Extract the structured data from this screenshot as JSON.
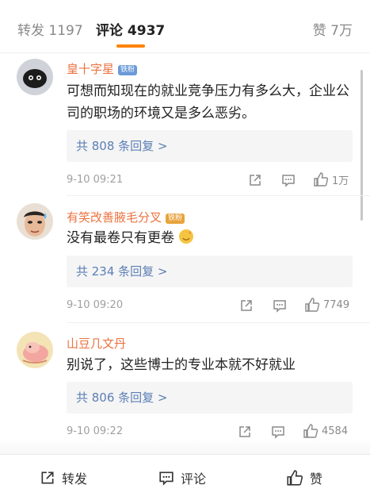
{
  "tabs": {
    "repost": "转发 1197",
    "comment": "评论 4937",
    "like": "赞 7万"
  },
  "comments": [
    {
      "username": "皇十字星",
      "badge": "铁粉",
      "text": "可想而知现在的就业竞争压力有多么大，企业公司的职场的环境又是多么恶劣。",
      "replies": "共 808 条回复 >",
      "time": "9-10 09:21",
      "likes": "1万"
    },
    {
      "username": "有笑改善腋毛分叉",
      "badge": "铁粉",
      "text": "没有最卷只有更卷",
      "replies": "共 234 条回复 >",
      "time": "9-10 09:20",
      "likes": "7749"
    },
    {
      "username": "山豆几文丹",
      "badge": "",
      "text": "别说了，这些博士的专业本就不好就业",
      "replies": "共 806 条回复 >",
      "time": "9-10 09:22",
      "likes": "4584"
    }
  ],
  "bottom_bar": {
    "repost": "转发",
    "comment": "评论",
    "like": "赞"
  },
  "colors": {
    "accent": "#ff8200",
    "username": "#eb7340",
    "reply_link": "#5b7fb5"
  }
}
